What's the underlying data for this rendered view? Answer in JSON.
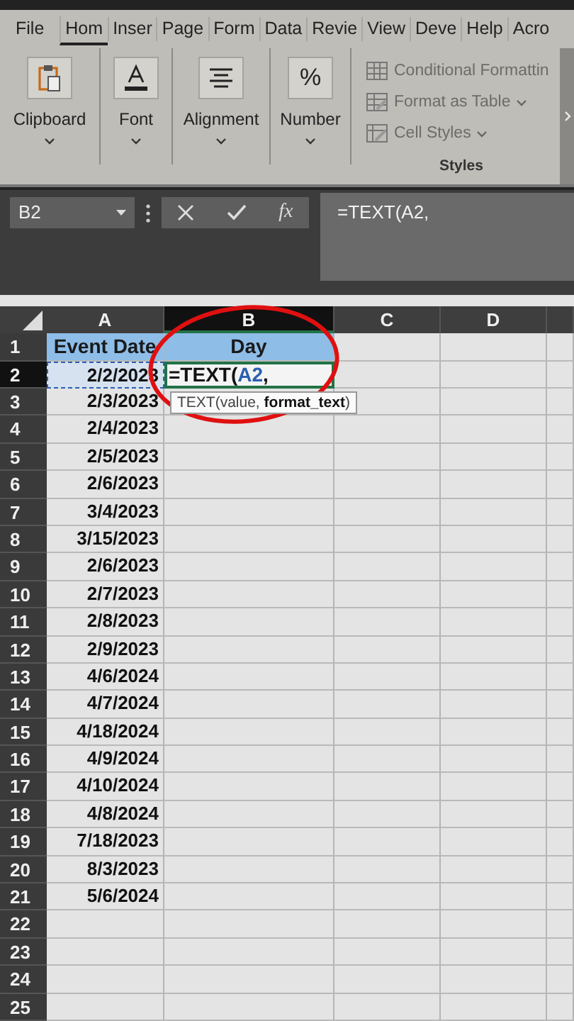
{
  "ribbon": {
    "tabs": [
      {
        "label": "File",
        "selected": false
      },
      {
        "label": "Hom",
        "selected": true
      },
      {
        "label": "Inser",
        "selected": false
      },
      {
        "label": "Page",
        "selected": false
      },
      {
        "label": "Form",
        "selected": false
      },
      {
        "label": "Data",
        "selected": false
      },
      {
        "label": "Revie",
        "selected": false
      },
      {
        "label": "View",
        "selected": false
      },
      {
        "label": "Deve",
        "selected": false
      },
      {
        "label": "Help",
        "selected": false
      },
      {
        "label": "Acro",
        "selected": false
      }
    ],
    "groups": [
      {
        "kind": "clipboard",
        "label": "Clipboard"
      },
      {
        "kind": "font",
        "label": "Font"
      },
      {
        "kind": "alignment",
        "label": "Alignment"
      },
      {
        "kind": "number",
        "label": "Number",
        "glyph": "%"
      }
    ],
    "styles": {
      "items": [
        {
          "kind": "conditional",
          "label": "Conditional Formattin",
          "dropdown": false
        },
        {
          "kind": "table",
          "label": "Format as Table",
          "dropdown": true
        },
        {
          "kind": "cellstyles",
          "label": "Cell Styles",
          "dropdown": true
        }
      ],
      "label": "Styles"
    }
  },
  "formula_bar": {
    "name_box": "B2",
    "function_label": "fx",
    "formula": "=TEXT(A2,"
  },
  "columns": [
    {
      "label": "A",
      "selected": false
    },
    {
      "label": "B",
      "selected": true
    },
    {
      "label": "C",
      "selected": false
    },
    {
      "label": "D",
      "selected": false
    }
  ],
  "rows": [
    {
      "number": "1",
      "selected": false,
      "kind": "header",
      "cells": [
        "Event Date",
        "Day"
      ]
    },
    {
      "number": "2",
      "selected": true,
      "kind": "edit",
      "cells": [
        "2/2/2023"
      ],
      "edit": [
        {
          "text": "=TEXT(",
          "ref": false
        },
        {
          "text": "A2",
          "ref": true
        },
        {
          "text": ",",
          "ref": false
        }
      ],
      "tooltip": "TEXT(value, **format_text**)"
    },
    {
      "number": "3",
      "selected": false,
      "kind": "data",
      "cells": [
        "2/3/2023"
      ]
    },
    {
      "number": "4",
      "selected": false,
      "kind": "data",
      "cells": [
        "2/4/2023"
      ]
    },
    {
      "number": "5",
      "selected": false,
      "kind": "data",
      "cells": [
        "2/5/2023"
      ]
    },
    {
      "number": "6",
      "selected": false,
      "kind": "data",
      "cells": [
        "2/6/2023"
      ]
    },
    {
      "number": "7",
      "selected": false,
      "kind": "data",
      "cells": [
        "3/4/2023"
      ]
    },
    {
      "number": "8",
      "selected": false,
      "kind": "data",
      "cells": [
        "3/15/2023"
      ]
    },
    {
      "number": "9",
      "selected": false,
      "kind": "data",
      "cells": [
        "2/6/2023"
      ]
    },
    {
      "number": "10",
      "selected": false,
      "kind": "data",
      "cells": [
        "2/7/2023"
      ]
    },
    {
      "number": "11",
      "selected": false,
      "kind": "data",
      "cells": [
        "2/8/2023"
      ]
    },
    {
      "number": "12",
      "selected": false,
      "kind": "data",
      "cells": [
        "2/9/2023"
      ]
    },
    {
      "number": "13",
      "selected": false,
      "kind": "data",
      "cells": [
        "4/6/2024"
      ]
    },
    {
      "number": "14",
      "selected": false,
      "kind": "data",
      "cells": [
        "4/7/2024"
      ]
    },
    {
      "number": "15",
      "selected": false,
      "kind": "data",
      "cells": [
        "4/18/2024"
      ]
    },
    {
      "number": "16",
      "selected": false,
      "kind": "data",
      "cells": [
        "4/9/2024"
      ]
    },
    {
      "number": "17",
      "selected": false,
      "kind": "data",
      "cells": [
        "4/10/2024"
      ]
    },
    {
      "number": "18",
      "selected": false,
      "kind": "data",
      "cells": [
        "4/8/2024"
      ]
    },
    {
      "number": "19",
      "selected": false,
      "kind": "data",
      "cells": [
        "7/18/2023"
      ]
    },
    {
      "number": "20",
      "selected": false,
      "kind": "data",
      "cells": [
        "8/3/2023"
      ]
    },
    {
      "number": "21",
      "selected": false,
      "kind": "data",
      "cells": [
        "5/6/2024"
      ]
    },
    {
      "number": "22",
      "selected": false,
      "kind": "empty"
    },
    {
      "number": "23",
      "selected": false,
      "kind": "empty"
    },
    {
      "number": "24",
      "selected": false,
      "kind": "empty"
    },
    {
      "number": "25",
      "selected": false,
      "kind": "empty"
    }
  ],
  "annotation": {
    "kind": "ellipse"
  }
}
